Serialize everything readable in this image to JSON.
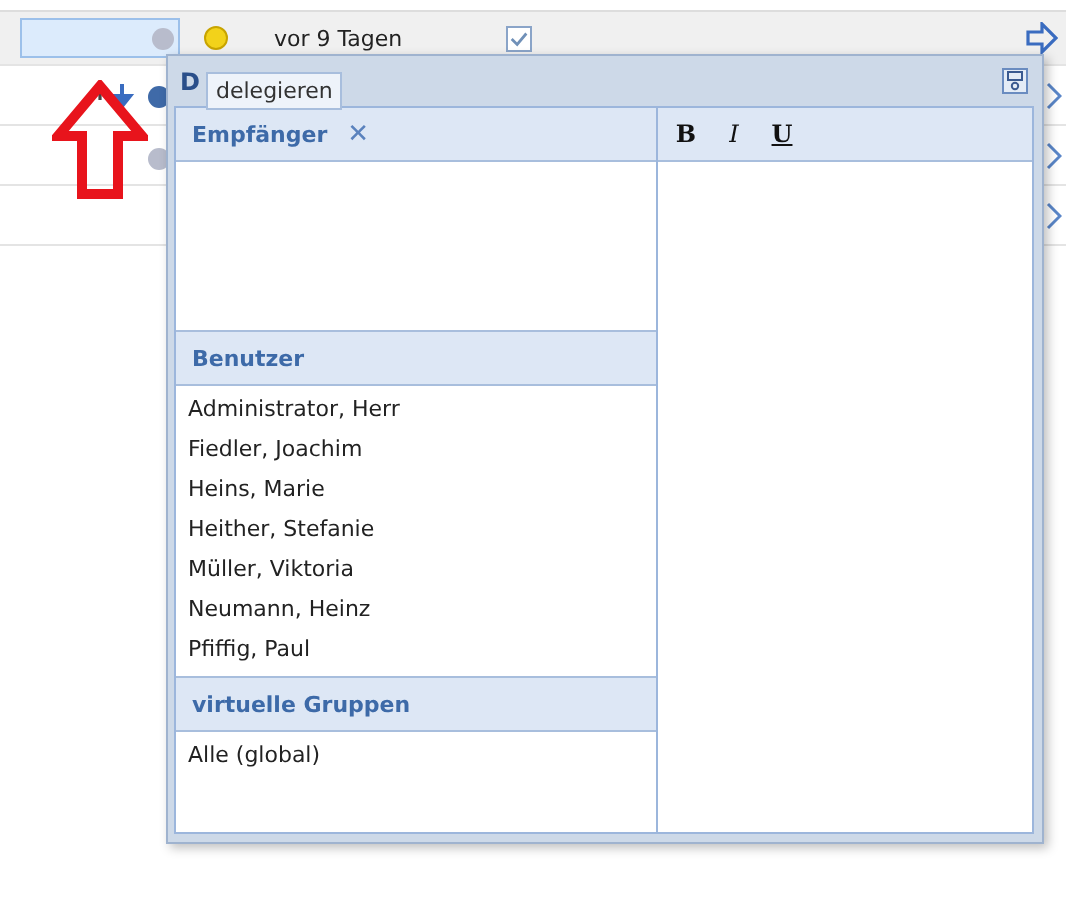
{
  "task_row": {
    "age": "vor 9 Tagen",
    "done": true
  },
  "dialog": {
    "title": "D",
    "tooltip": "delegieren",
    "recipients": {
      "title": "Empfänger",
      "clear": "✕"
    },
    "editor": {
      "tools": [
        {
          "label": "B",
          "kind": "bold"
        },
        {
          "label": "I",
          "kind": "italic"
        },
        {
          "label": "U",
          "kind": "underline"
        }
      ]
    },
    "sections": [
      {
        "title": "Benutzer",
        "items": [
          "Administrator, Herr",
          "Fiedler, Joachim",
          "Heins, Marie",
          "Heither, Stefanie",
          "Müller, Viktoria",
          "Neumann, Heinz",
          "Pfiffig, Paul"
        ]
      },
      {
        "title": "virtuelle Gruppen",
        "items": [
          "Alle (global)"
        ]
      }
    ]
  }
}
